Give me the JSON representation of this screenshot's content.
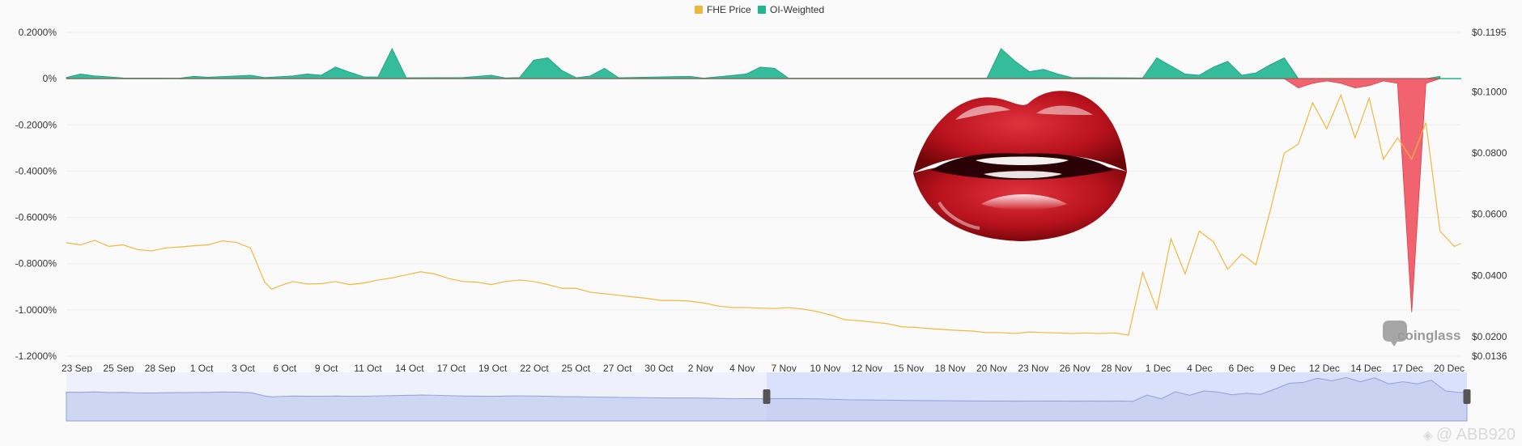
{
  "chart_data": {
    "type": "area",
    "legend": {
      "position": "top-center",
      "items": [
        {
          "name": "FHE Price",
          "color": "#f0b73e"
        },
        {
          "name": "OI-Weighted",
          "color": "#1fb58f"
        }
      ]
    },
    "x_labels": [
      "23 Sep",
      "25 Sep",
      "28 Sep",
      "1 Oct",
      "3 Oct",
      "6 Oct",
      "9 Oct",
      "11 Oct",
      "14 Oct",
      "17 Oct",
      "19 Oct",
      "22 Oct",
      "25 Oct",
      "27 Oct",
      "30 Oct",
      "2 Nov",
      "4 Nov",
      "7 Nov",
      "10 Nov",
      "12 Nov",
      "15 Nov",
      "18 Nov",
      "20 Nov",
      "23 Nov",
      "26 Nov",
      "28 Nov",
      "1 Dec",
      "4 Dec",
      "6 Dec",
      "9 Dec",
      "12 Dec",
      "14 Dec",
      "17 Dec",
      "20 Dec"
    ],
    "left_axis": {
      "ticks": [
        "0.2000%",
        "0%",
        "-0.2000%",
        "-0.4000%",
        "-0.6000%",
        "-0.8000%",
        "-1.0000%",
        "-1.2000%"
      ],
      "ylim": [
        -1.2,
        0.2
      ]
    },
    "right_axis": {
      "ticks": [
        "$0.1195",
        "$0.1000",
        "$0.0800",
        "$0.0600",
        "$0.0400",
        "$0.0200",
        "$0.0136"
      ],
      "ylim": [
        0.0136,
        0.1195
      ]
    },
    "grid": true,
    "series": [
      {
        "name": "FHE Price",
        "axis": "right",
        "points": [
          [
            0,
            0.0507
          ],
          [
            1,
            0.05
          ],
          [
            2,
            0.0515
          ],
          [
            3,
            0.0495
          ],
          [
            4,
            0.05
          ],
          [
            5,
            0.0485
          ],
          [
            6,
            0.048
          ],
          [
            7,
            0.049
          ],
          [
            8,
            0.0493
          ],
          [
            9,
            0.0497
          ],
          [
            10,
            0.05
          ],
          [
            11,
            0.0513
          ],
          [
            12,
            0.0508
          ],
          [
            13,
            0.049
          ],
          [
            14,
            0.0378
          ],
          [
            14.5,
            0.0355
          ],
          [
            15,
            0.0365
          ],
          [
            16,
            0.038
          ],
          [
            17,
            0.0372
          ],
          [
            18,
            0.0373
          ],
          [
            19,
            0.038
          ],
          [
            20,
            0.037
          ],
          [
            21,
            0.0375
          ],
          [
            22,
            0.0385
          ],
          [
            23,
            0.0392
          ],
          [
            24,
            0.0402
          ],
          [
            25,
            0.0412
          ],
          [
            26,
            0.0405
          ],
          [
            27,
            0.039
          ],
          [
            28,
            0.038
          ],
          [
            29,
            0.0378
          ],
          [
            30,
            0.037
          ],
          [
            31,
            0.038
          ],
          [
            32,
            0.0385
          ],
          [
            33,
            0.038
          ],
          [
            34,
            0.037
          ],
          [
            35,
            0.0358
          ],
          [
            36,
            0.0358
          ],
          [
            37,
            0.0345
          ],
          [
            38,
            0.034
          ],
          [
            39,
            0.0335
          ],
          [
            40,
            0.033
          ],
          [
            41,
            0.0325
          ],
          [
            42,
            0.0318
          ],
          [
            43,
            0.0318
          ],
          [
            44,
            0.0316
          ],
          [
            45,
            0.031
          ],
          [
            46,
            0.03
          ],
          [
            47,
            0.0295
          ],
          [
            48,
            0.0295
          ],
          [
            49,
            0.0293
          ],
          [
            50,
            0.0292
          ],
          [
            51,
            0.0295
          ],
          [
            52,
            0.029
          ],
          [
            53,
            0.0282
          ],
          [
            54,
            0.027
          ],
          [
            55,
            0.0255
          ],
          [
            56,
            0.0252
          ],
          [
            57,
            0.0247
          ],
          [
            58,
            0.0242
          ],
          [
            59,
            0.0232
          ],
          [
            60,
            0.023
          ],
          [
            61,
            0.0226
          ],
          [
            62,
            0.0223
          ],
          [
            63,
            0.022
          ],
          [
            64,
            0.0218
          ],
          [
            65,
            0.0213
          ],
          [
            66,
            0.0213
          ],
          [
            67,
            0.021
          ],
          [
            68,
            0.0215
          ],
          [
            69,
            0.0213
          ],
          [
            70,
            0.0212
          ],
          [
            71,
            0.021
          ],
          [
            72,
            0.0212
          ],
          [
            73,
            0.021
          ],
          [
            74,
            0.0212
          ],
          [
            75,
            0.0205
          ],
          [
            76,
            0.041
          ],
          [
            77,
            0.029
          ],
          [
            78,
            0.052
          ],
          [
            79,
            0.0405
          ],
          [
            80,
            0.0545
          ],
          [
            81,
            0.051
          ],
          [
            82,
            0.042
          ],
          [
            83,
            0.047
          ],
          [
            84,
            0.0435
          ],
          [
            85,
            0.061
          ],
          [
            86,
            0.08
          ],
          [
            87,
            0.083
          ],
          [
            88,
            0.0965
          ],
          [
            89,
            0.088
          ],
          [
            90,
            0.099
          ],
          [
            91,
            0.085
          ],
          [
            92,
            0.098
          ],
          [
            93,
            0.078
          ],
          [
            94,
            0.085
          ],
          [
            95,
            0.078
          ],
          [
            96,
            0.09
          ],
          [
            97,
            0.0545
          ],
          [
            98,
            0.0495
          ],
          [
            98.5,
            0.0505
          ]
        ]
      },
      {
        "name": "OI-Weighted",
        "axis": "left",
        "unit": "%",
        "points": [
          [
            0,
            0.005
          ],
          [
            1,
            0.02
          ],
          [
            2,
            0.012
          ],
          [
            3,
            0.008
          ],
          [
            4,
            0.003
          ],
          [
            8,
            0.002
          ],
          [
            9,
            0.01
          ],
          [
            10,
            0.006
          ],
          [
            12,
            0.012
          ],
          [
            13,
            0.015
          ],
          [
            14,
            0.005
          ],
          [
            16,
            0.012
          ],
          [
            17,
            0.02
          ],
          [
            18,
            0.015
          ],
          [
            19,
            0.05
          ],
          [
            20,
            0.028
          ],
          [
            21,
            0.008
          ],
          [
            22,
            0.007
          ],
          [
            23,
            0.13
          ],
          [
            24,
            0.004
          ],
          [
            28,
            0.005
          ],
          [
            30,
            0.015
          ],
          [
            31,
            0.003
          ],
          [
            32,
            0.005
          ],
          [
            33,
            0.08
          ],
          [
            34,
            0.09
          ],
          [
            35,
            0.035
          ],
          [
            36,
            0.004
          ],
          [
            37,
            0.012
          ],
          [
            38,
            0.045
          ],
          [
            39,
            0.004
          ],
          [
            44,
            0.01
          ],
          [
            45,
            0.002
          ],
          [
            48,
            0.02
          ],
          [
            49,
            0.05
          ],
          [
            50,
            0.045
          ],
          [
            51,
            0.002
          ],
          [
            65,
            0.002
          ],
          [
            66,
            0.13
          ],
          [
            67,
            0.075
          ],
          [
            68,
            0.03
          ],
          [
            69,
            0.04
          ],
          [
            70,
            0.02
          ],
          [
            71,
            0.005
          ],
          [
            76,
            0.003
          ],
          [
            77,
            0.09
          ],
          [
            78,
            0.055
          ],
          [
            79,
            0.02
          ],
          [
            80,
            0.015
          ],
          [
            81,
            0.05
          ],
          [
            82,
            0.075
          ],
          [
            83,
            0.015
          ],
          [
            84,
            0.025
          ],
          [
            85,
            0.06
          ],
          [
            86,
            0.09
          ],
          [
            87,
            -0.04
          ],
          [
            88,
            -0.02
          ],
          [
            89,
            -0.01
          ],
          [
            90,
            -0.02
          ],
          [
            91,
            -0.04
          ],
          [
            92,
            -0.03
          ],
          [
            93,
            -0.01
          ],
          [
            94,
            -0.02
          ],
          [
            95,
            -1.01
          ],
          [
            96,
            -0.02
          ],
          [
            97,
            0.01
          ]
        ]
      }
    ],
    "navigator": {
      "range_start": 0.5,
      "range_end": 1.0
    }
  },
  "watermark": "coinglass",
  "credit": "@ ABB920"
}
